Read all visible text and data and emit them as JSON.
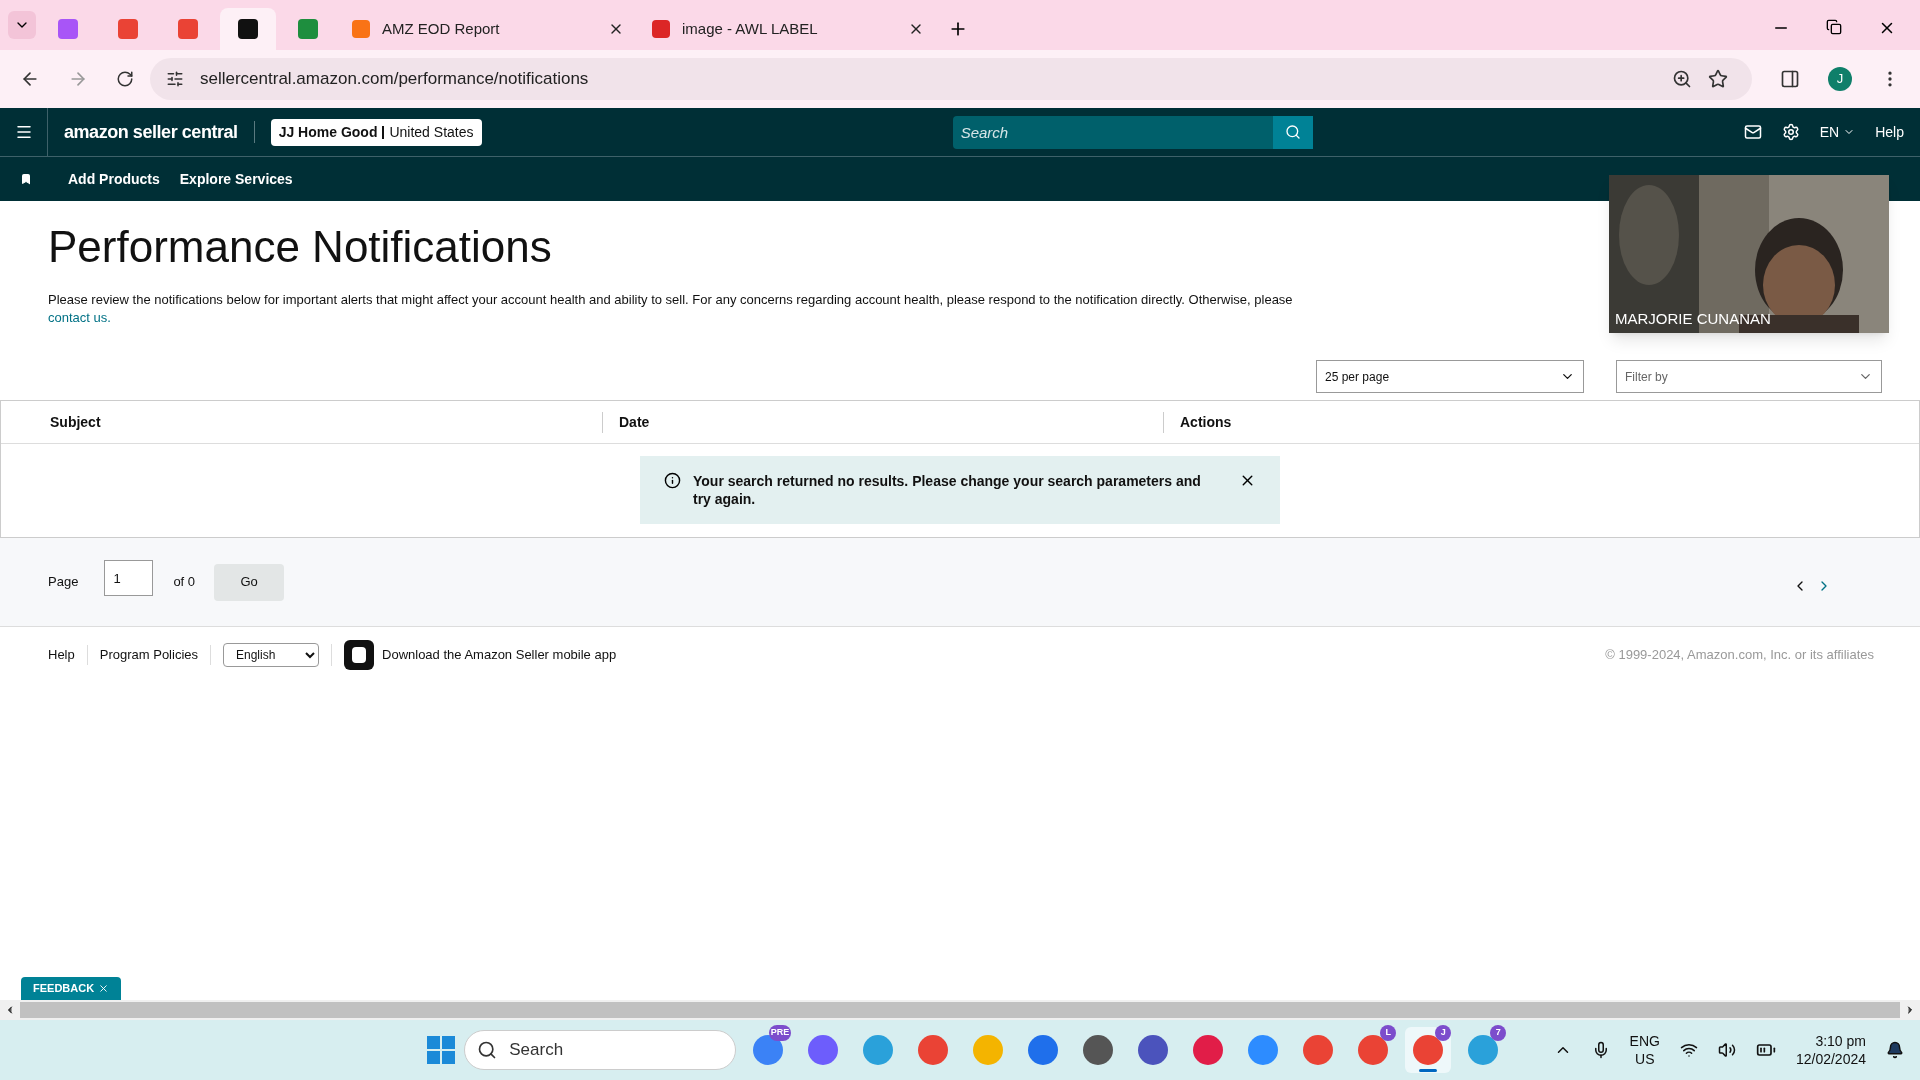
{
  "browser": {
    "icon_tabs": [
      {
        "selected": false
      },
      {
        "selected": false
      },
      {
        "selected": false
      },
      {
        "selected": true
      },
      {
        "selected": false
      }
    ],
    "tabs": [
      {
        "label": "AMZ EOD Report",
        "selected": false
      },
      {
        "label": "image - AWL LABEL",
        "selected": false
      }
    ],
    "url": "sellercentral.amazon.com/performance/notifications",
    "profile": "J"
  },
  "header": {
    "logo": "amazon seller central",
    "store": "JJ Home Good",
    "region": "United States",
    "search_placeholder": "Search",
    "language": "EN",
    "help": "Help"
  },
  "subnav": [
    "Add Products",
    "Explore Services"
  ],
  "page": {
    "title": "Performance Notifications",
    "description": "Please review the notifications below for important alerts that might affect your account health and ability to sell. For any concerns regarding account health, please respond to the notification directly. Otherwise, please",
    "contact_link": "contact us."
  },
  "controls": {
    "per_page": "25 per page",
    "filter_placeholder": "Filter by"
  },
  "table": {
    "columns": [
      "Subject",
      "Date",
      "Actions"
    ],
    "message": "Your search returned no results. Please change your search parameters and try again."
  },
  "pagination": {
    "label": "Page",
    "value": "1",
    "of": "of 0",
    "go": "Go"
  },
  "footer": {
    "links": [
      "Help",
      "Program Policies"
    ],
    "language": "English",
    "app_link": "Download the Amazon Seller mobile app",
    "copyright": "© 1999-2024, Amazon.com, Inc. or its affiliates"
  },
  "video": {
    "name": "MARJORIE CUNANAN"
  },
  "feedback": "FEEDBACK",
  "taskbar": {
    "search": "Search",
    "apps": [
      {
        "active": false,
        "badge": "PRE"
      },
      {
        "active": false
      },
      {
        "active": false
      },
      {
        "active": false
      },
      {
        "active": false
      },
      {
        "active": false
      },
      {
        "active": false
      },
      {
        "active": false
      },
      {
        "active": false
      },
      {
        "active": false
      },
      {
        "active": false
      },
      {
        "active": false,
        "badge": "L"
      },
      {
        "active": true,
        "badge": "J"
      },
      {
        "active": false,
        "badge": "7"
      }
    ],
    "lang": "ENG",
    "region": "US",
    "time": "3:10 pm",
    "date": "12/02/2024"
  }
}
